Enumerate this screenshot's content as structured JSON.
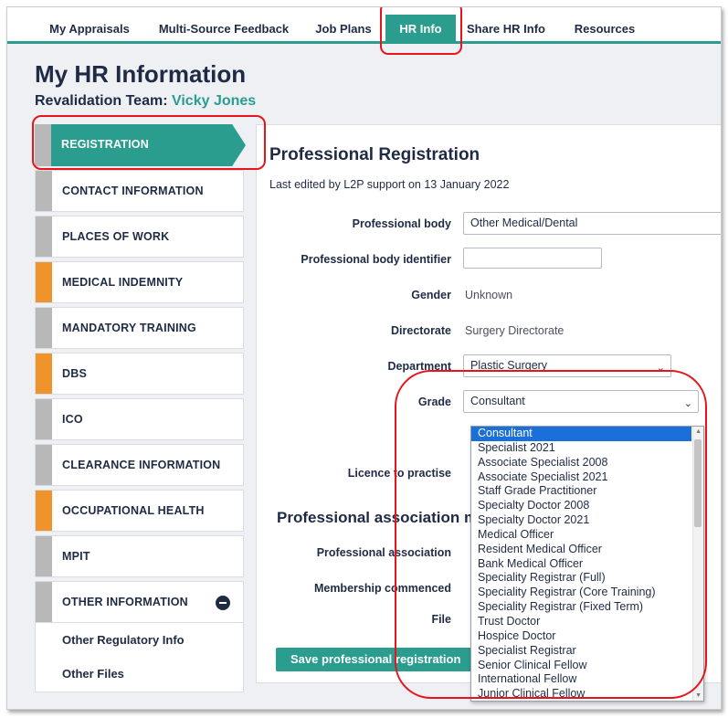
{
  "nav": {
    "tabs": [
      {
        "label": "My Appraisals"
      },
      {
        "label": "Multi-Source Feedback"
      },
      {
        "label": "Job Plans"
      },
      {
        "label": "HR Info"
      },
      {
        "label": "Share HR Info"
      },
      {
        "label": "Resources"
      }
    ],
    "active_index": 3
  },
  "header": {
    "title": "My HR Information",
    "team_label": "Revalidation Team: ",
    "team_name": "Vicky Jones"
  },
  "sidebar": {
    "items": [
      {
        "label": "REGISTRATION",
        "status_color": "#2a9d8f",
        "active": true
      },
      {
        "label": "CONTACT INFORMATION",
        "status_color": "#b8b8b8"
      },
      {
        "label": "PLACES OF WORK",
        "status_color": "#b8b8b8"
      },
      {
        "label": "MEDICAL INDEMNITY",
        "status_color": "#f0932b"
      },
      {
        "label": "MANDATORY TRAINING",
        "status_color": "#b8b8b8"
      },
      {
        "label": "DBS",
        "status_color": "#f0932b"
      },
      {
        "label": "ICO",
        "status_color": "#b8b8b8"
      },
      {
        "label": "CLEARANCE INFORMATION",
        "status_color": "#b8b8b8"
      },
      {
        "label": "OCCUPATIONAL HEALTH",
        "status_color": "#f0932b"
      },
      {
        "label": "MPIT",
        "status_color": "#b8b8b8"
      },
      {
        "label": "OTHER INFORMATION",
        "status_color": "#b8b8b8",
        "expanded": true
      }
    ],
    "sub_items": [
      {
        "label": "Other Regulatory Info"
      },
      {
        "label": "Other Files"
      }
    ]
  },
  "main": {
    "title": "Professional Registration",
    "last_edited": "Last edited by L2P support on 13 January 2022",
    "fields": {
      "professional_body": {
        "label": "Professional body",
        "value": "Other Medical/Dental"
      },
      "professional_body_identifier": {
        "label": "Professional body identifier",
        "value": ""
      },
      "gender": {
        "label": "Gender",
        "value": "Unknown"
      },
      "directorate": {
        "label": "Directorate",
        "value": "Surgery Directorate"
      },
      "department": {
        "label": "Department",
        "value": "Plastic Surgery"
      },
      "grade": {
        "label": "Grade",
        "value": "Consultant"
      },
      "licence": {
        "label": "Licence to practise"
      }
    },
    "association_title": "Professional association m",
    "association_fields": {
      "professional_association": {
        "label": "Professional association"
      },
      "membership_commenced": {
        "label": "Membership commenced"
      },
      "file": {
        "label": "File"
      }
    },
    "save_button": "Save professional registration"
  },
  "grade_options": [
    "Consultant",
    "Specialist 2021",
    "Associate Specialist 2008",
    "Associate Specialist 2021",
    "Staff Grade Practitioner",
    "Specialty Doctor 2008",
    "Specialty Doctor 2021",
    "Medical Officer",
    "Resident Medical Officer",
    "Bank Medical Officer",
    "Speciality Registrar (Full)",
    "Speciality Registrar (Core Training)",
    "Speciality Registrar (Fixed Term)",
    "Trust Doctor",
    "Hospice Doctor",
    "Specialist Registrar",
    "Senior Clinical Fellow",
    "International Fellow",
    "Junior Clinical Fellow"
  ],
  "grade_selected_index": 0,
  "colors": {
    "accent": "#2a9d8f",
    "warning": "#f0932b",
    "neutral": "#b8b8b8",
    "annotation": "#e8141b",
    "selection": "#1a6fd8"
  }
}
